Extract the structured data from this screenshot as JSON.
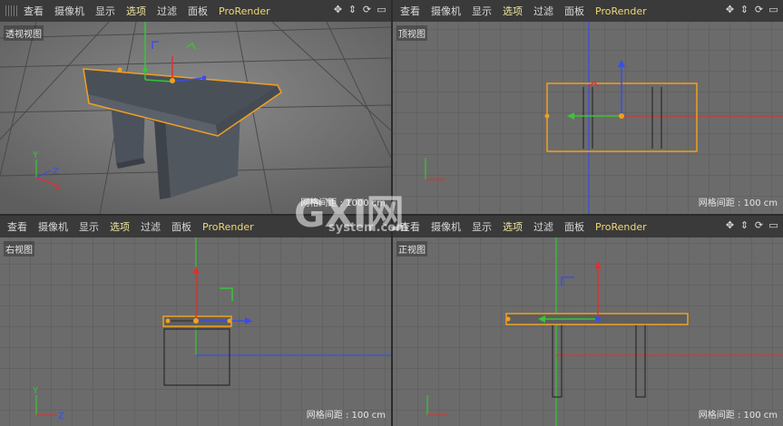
{
  "menu": {
    "items": [
      "查看",
      "摄像机",
      "显示",
      "选项",
      "过滤",
      "面板"
    ],
    "highlighted_item": "选项",
    "plugin": "ProRender"
  },
  "nav_icons": [
    "move-view-icon",
    "dolly-view-icon",
    "rotate-view-icon",
    "maximize-view-icon"
  ],
  "viewports": {
    "perspective": {
      "label": "透视视图",
      "grid_spacing": "网格间距 : 1000 cm"
    },
    "top": {
      "label": "顶视图",
      "grid_spacing": "网格间距 : 100 cm"
    },
    "right": {
      "label": "右视图",
      "grid_spacing": "网格间距 : 100 cm"
    },
    "front": {
      "label": "正视图",
      "grid_spacing": "网格间距 : 100 cm"
    }
  },
  "axis_labels": {
    "x": "X",
    "y": "Y",
    "z": "Z"
  },
  "watermark": {
    "logo": "GXI网",
    "site": "system.com"
  },
  "colors": {
    "axis_x": "#e03030",
    "axis_y": "#36c636",
    "axis_z": "#3a4ee6",
    "selection": "#f0a020",
    "menu_highlight": "#f0e6a0"
  }
}
